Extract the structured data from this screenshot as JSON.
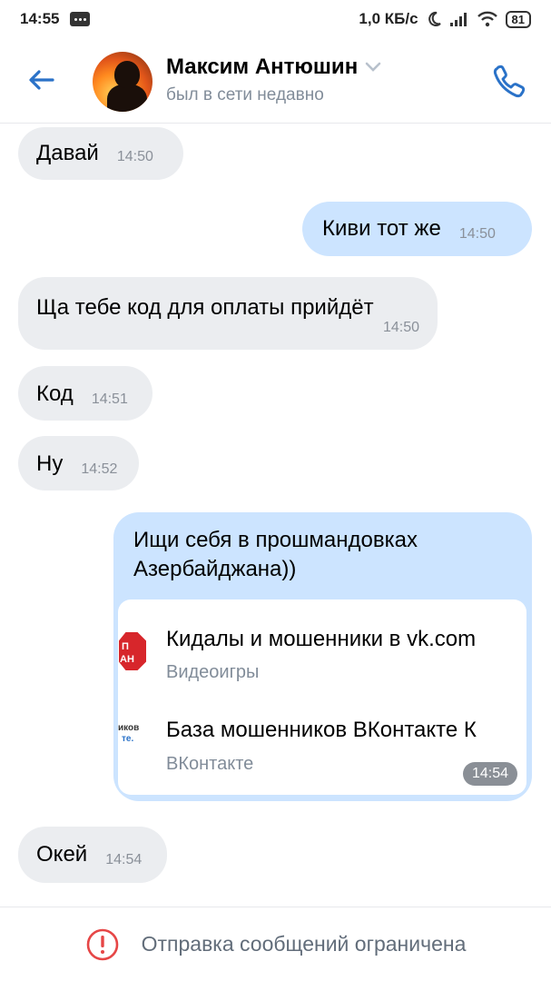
{
  "status_bar": {
    "time": "14:55",
    "speed": "1,0 КБ/с",
    "battery": "81"
  },
  "header": {
    "name": "Максим Антюшин",
    "status": "был в сети недавно"
  },
  "messages": [
    {
      "dir": "in",
      "text": "Давай",
      "time": "14:50"
    },
    {
      "dir": "out",
      "text": "Киви тот же",
      "time": "14:50"
    },
    {
      "dir": "in",
      "text": "Ща тебе код для оплаты прийдёт",
      "time": "14:50"
    },
    {
      "dir": "in",
      "text": "Код",
      "time": "14:51"
    },
    {
      "dir": "in",
      "text": "Ну",
      "time": "14:52"
    },
    {
      "dir": "out",
      "text_line1": "Ищи себя в прошмандовках",
      "text_line2": "Азербайджана))",
      "time": "14:54"
    },
    {
      "dir": "in",
      "text": "Окей",
      "time": "14:54"
    }
  ],
  "links": [
    {
      "title": "Кидалы и мошенники в vk.com",
      "subtitle": "Видеоигры",
      "thumb_text_1": "П",
      "thumb_text_2": "АН"
    },
    {
      "title": "База мошенников ВКонтакте  К",
      "subtitle": "ВКонтакте",
      "thumb_text_1": "иков",
      "thumb_text_2": "те."
    }
  ],
  "footer": {
    "text": "Отправка сообщений ограничена"
  },
  "colors": {
    "accent": "#2a72c8",
    "incoming_bubble": "#ebedf0",
    "outgoing_bubble": "#cce4ff",
    "warning": "#e64646"
  }
}
